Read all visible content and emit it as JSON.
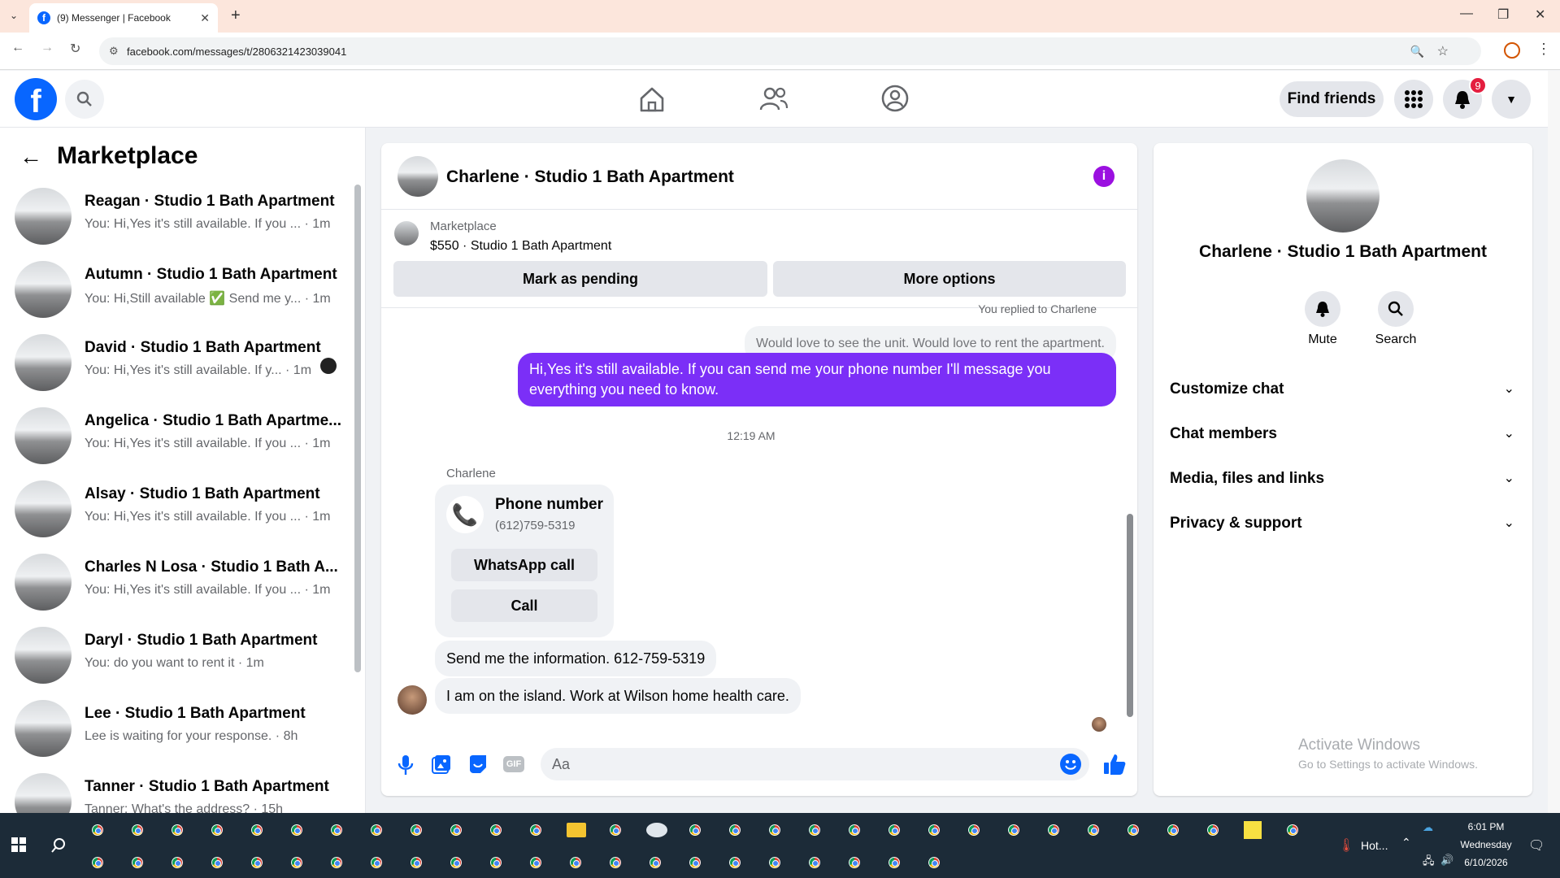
{
  "browser": {
    "tab_title": "(9) Messenger | Facebook",
    "url": "facebook.com/messages/t/2806321423039041"
  },
  "header": {
    "find_friends": "Find friends",
    "notif_count": "9"
  },
  "sidebar": {
    "title": "Marketplace",
    "items": [
      {
        "name": "Reagan · Studio 1 Bath Apartment",
        "preview": "You: Hi,Yes it's still available. If you ... · 1m"
      },
      {
        "name": "Autumn · Studio 1 Bath Apartment",
        "preview": "You: Hi,Still available ✅ Send me y... · 1m"
      },
      {
        "name": "David · Studio 1 Bath Apartment",
        "preview": "You: Hi,Yes it's still available. If y... · 1m"
      },
      {
        "name": "Angelica · Studio 1 Bath Apartme...",
        "preview": "You: Hi,Yes it's still available. If you ... · 1m"
      },
      {
        "name": "Alsay · Studio 1 Bath Apartment",
        "preview": "You: Hi,Yes it's still available. If you ... · 1m"
      },
      {
        "name": "Charles N Losa · Studio 1 Bath A...",
        "preview": "You: Hi,Yes it's still available. If you ... · 1m"
      },
      {
        "name": "Daryl · Studio 1 Bath Apartment",
        "preview": "You: do you want to rent it · 1m"
      },
      {
        "name": "Lee · Studio 1 Bath Apartment",
        "preview": "Lee is waiting for your response. · 8h"
      },
      {
        "name": "Tanner · Studio 1 Bath Apartment",
        "preview": "Tanner: What's the address? · 15h"
      }
    ]
  },
  "chat": {
    "title": "Charlene · Studio 1 Bath Apartment",
    "listing_label": "Marketplace",
    "listing_price": "$550 · Studio 1 Bath Apartment",
    "mark_pending": "Mark as pending",
    "more_options": "More options",
    "replied_to": "You replied to Charlene",
    "quoted": "Would love to see the unit. Would love to rent the apartment.",
    "my_message": "Hi,Yes it's still available. If you can send me your phone number I'll message you everything you need to know.",
    "timestamp": "12:19 AM",
    "sender": "Charlene",
    "phone_title": "Phone number",
    "phone_value": "(612)759-5319",
    "whatsapp_call": "WhatsApp call",
    "call": "Call",
    "msg1": "Send me the information. 612-759-5319",
    "msg2": "I am on the island. Work at Wilson home health care.",
    "input_placeholder": "Aa"
  },
  "details": {
    "title": "Charlene · Studio 1 Bath Apartment",
    "mute": "Mute",
    "search": "Search",
    "rows": [
      "Customize chat",
      "Chat members",
      "Media, files and links",
      "Privacy & support"
    ],
    "activate_title": "Activate Windows",
    "activate_sub": "Go to Settings to activate Windows."
  },
  "taskbar": {
    "weather": "Hot...",
    "time": "6:01 PM",
    "day": "Wednesday",
    "date": "6/10/2026"
  }
}
